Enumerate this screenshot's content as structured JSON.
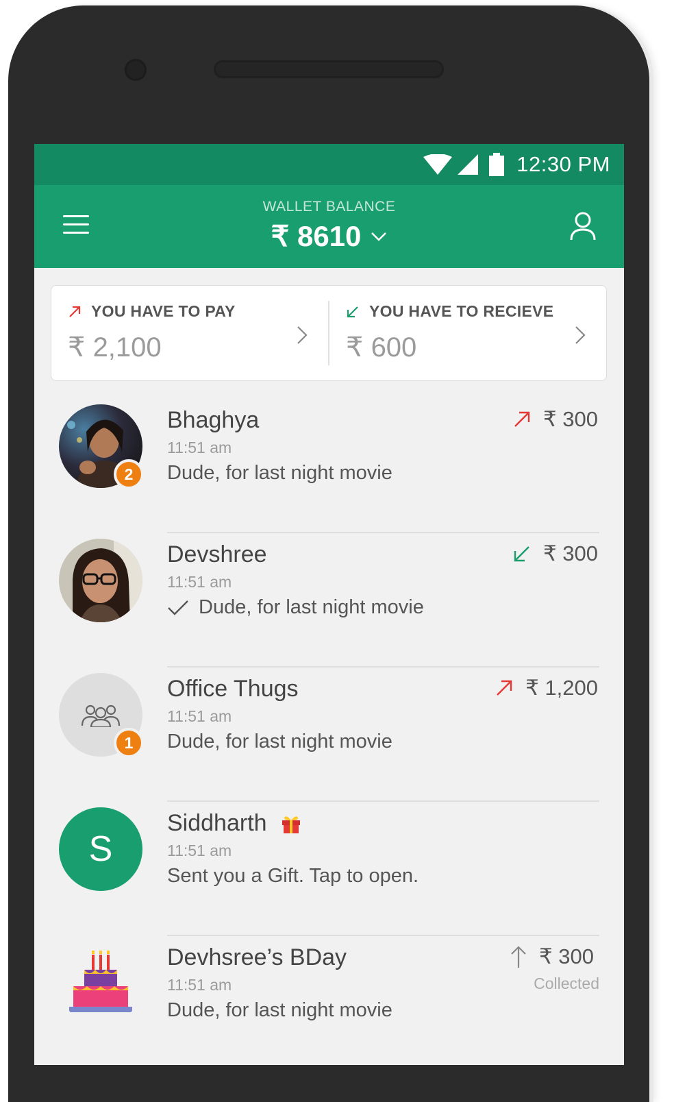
{
  "status_bar": {
    "time": "12:30 PM"
  },
  "app_bar": {
    "menu_icon": "hamburger-menu-icon",
    "wallet_label": "WALLET BALANCE",
    "wallet_amount": "₹ 8610",
    "profile_icon": "person-icon"
  },
  "summary": {
    "pay": {
      "title": "YOU HAVE TO PAY",
      "amount": "₹ 2,100",
      "color": "#e53935"
    },
    "receive": {
      "title": "YOU HAVE TO RECIEVE",
      "amount": "₹ 600",
      "color": "#1a9e6e"
    }
  },
  "transactions": [
    {
      "name": "Bhaghya",
      "time": "11:51 am",
      "message": "Dude, for last night movie",
      "amount": "₹ 300",
      "direction": "outgoing",
      "badge": "2",
      "avatar": "photo"
    },
    {
      "name": "Devshree",
      "time": "11:51 am",
      "message": "Dude, for last night movie",
      "amount": "₹ 300",
      "direction": "incoming",
      "read": true,
      "avatar": "photo"
    },
    {
      "name": "Office Thugs",
      "time": "11:51 am",
      "message": "Dude, for last night movie",
      "amount": "₹ 1,200",
      "direction": "outgoing",
      "badge": "1",
      "avatar": "group-icon"
    },
    {
      "name": "Siddharth",
      "time": "11:51 am",
      "message": "Sent you a Gift. Tap to open.",
      "initial": "S",
      "avatar": "initial",
      "gift_icon": "gift-icon"
    },
    {
      "name": "Devhsree’s BDay",
      "time": "11:51 am",
      "message": "Dude, for last night movie",
      "amount": "₹ 300",
      "sub_label": "Collected",
      "direction": "collected",
      "avatar": "cake-icon"
    }
  ],
  "colors": {
    "status_bar": "#148a62",
    "app_bar": "#199e70",
    "badge": "#ee8012",
    "outgoing": "#e53935",
    "incoming": "#1a9e6e"
  }
}
